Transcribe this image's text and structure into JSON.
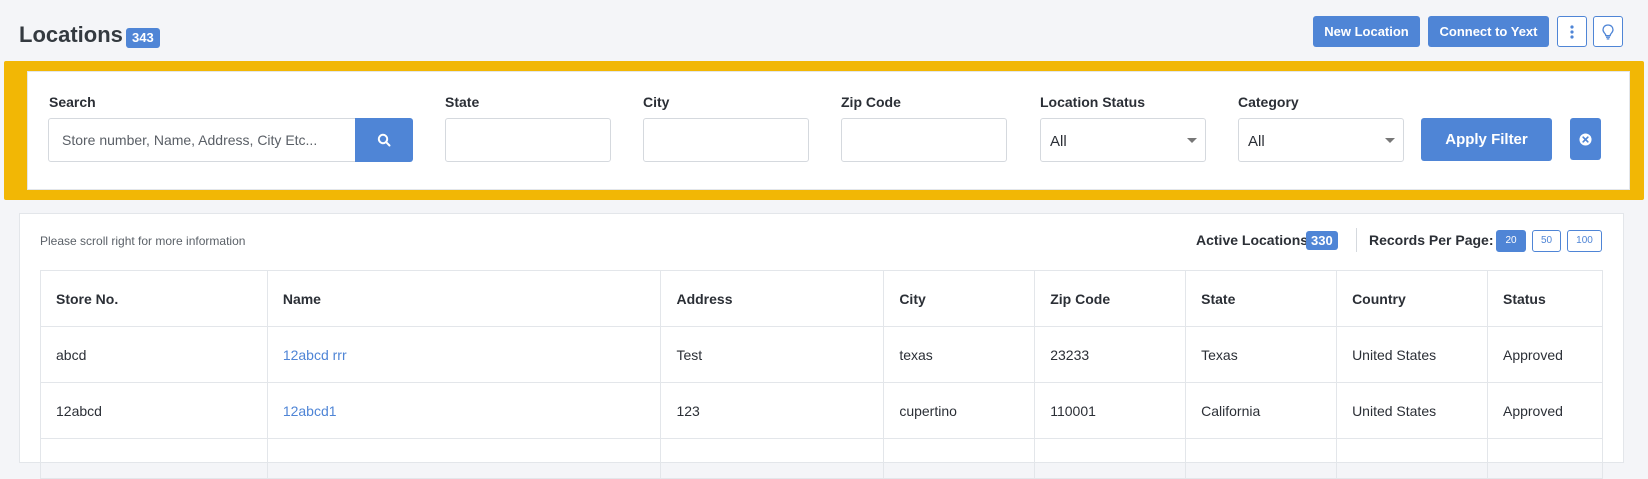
{
  "header": {
    "title": "Locations",
    "count": "343",
    "new_location_label": "New Location",
    "connect_label": "Connect to Yext",
    "more_icon": "vertical-dots-icon",
    "tips_icon": "lightbulb-icon"
  },
  "filters": {
    "search": {
      "label": "Search",
      "placeholder": "Store number, Name, Address, City Etc...",
      "value": ""
    },
    "state": {
      "label": "State",
      "value": ""
    },
    "city": {
      "label": "City",
      "value": ""
    },
    "zip": {
      "label": "Zip Code",
      "value": ""
    },
    "location_status": {
      "label": "Location Status",
      "selected": "All"
    },
    "category": {
      "label": "Category",
      "selected": "All"
    },
    "apply_label": "Apply Filter",
    "highlight_color": "#f2b705"
  },
  "results": {
    "scroll_hint": "Please scroll right for more information",
    "active_label": "Active Locations",
    "active_count": "330",
    "records_label": "Records Per Page:",
    "records_options": [
      "20",
      "50",
      "100"
    ],
    "records_selected": "20"
  },
  "table": {
    "columns": [
      "Store No.",
      "Name",
      "Address",
      "City",
      "Zip Code",
      "State",
      "Country",
      "Status"
    ],
    "rows": [
      [
        "abcd",
        "12abcd rrr",
        "Test",
        "texas",
        "23233",
        "Texas",
        "United States",
        "Approved"
      ],
      [
        "12abcd",
        "12abcd1",
        "123",
        "cupertino",
        "110001",
        "California",
        "United States",
        "Approved"
      ],
      [
        "",
        "",
        "",
        "",
        "",
        "",
        "",
        ""
      ]
    ]
  },
  "colors": {
    "accent": "#4f85d6",
    "background": "#f4f5f8"
  }
}
